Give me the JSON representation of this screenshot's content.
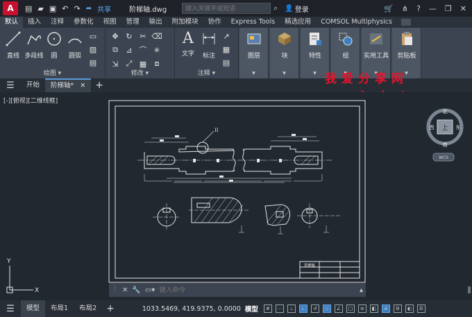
{
  "titlebar": {
    "logo": "A",
    "share_label": "共享",
    "doc_title": "阶梯轴.dwg",
    "search_placeholder": "键入关键字或短语",
    "login_label": "登录"
  },
  "ribbon_tabs": [
    "默认",
    "插入",
    "注释",
    "参数化",
    "视图",
    "管理",
    "输出",
    "附加模块",
    "协作",
    "Express Tools",
    "精选应用",
    "COMSOL Multiphysics"
  ],
  "ribbon": {
    "draw": {
      "title": "绘图",
      "line": "直线",
      "polyline": "多段线",
      "circle": "圆",
      "arc": "圆弧"
    },
    "modify": {
      "title": "修改"
    },
    "annotation": {
      "title": "注释",
      "text": "文字",
      "dimension": "标注"
    },
    "layers": "图层",
    "block": "块",
    "properties": "特性",
    "group": "组",
    "utilities": "实用工具",
    "clipboard": "剪贴板"
  },
  "doc_tabs": {
    "start": "开始",
    "current": "阶梯轴*"
  },
  "watermark": {
    "line1": "我爱分享网",
    "line2": "www.zhanshaoyi.com"
  },
  "viewport": {
    "label": "[-][俯视][二维线框]"
  },
  "viewcube": {
    "north": "北",
    "south": "南",
    "east": "东",
    "west": "西",
    "top": "上",
    "wcs": "WCS"
  },
  "ucs": {
    "x": "X",
    "y": "Y"
  },
  "drawing": {
    "section_label": "II",
    "title_block_text": "阶梯轴"
  },
  "command": {
    "placeholder": "键入命令"
  },
  "status": {
    "tabs": [
      "模型",
      "布局1",
      "布局2"
    ],
    "coords": "1033.5469, 419.9375, 0.0000",
    "model": "模型"
  }
}
